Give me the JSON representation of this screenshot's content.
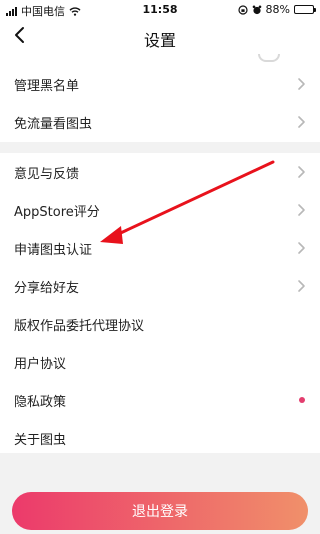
{
  "status_bar": {
    "carrier": "中国电信",
    "time": "11:58",
    "battery_percent": "88%",
    "battery_level": 0.88
  },
  "header": {
    "title": "设置",
    "back_icon": "chevron-left-icon"
  },
  "section_top": {
    "items": [
      {
        "label": "管理黑名单",
        "chevron": true
      },
      {
        "label": "免流量看图虫",
        "chevron": true
      }
    ]
  },
  "section_main": {
    "items": [
      {
        "label": "意见与反馈",
        "chevron": true
      },
      {
        "label": "AppStore评分",
        "chevron": true
      },
      {
        "label": "申请图虫认证",
        "chevron": true
      },
      {
        "label": "分享给好友",
        "chevron": true
      },
      {
        "label": "版权作品委托代理协议",
        "chevron": false
      },
      {
        "label": "用户协议",
        "chevron": false
      },
      {
        "label": "隐私政策",
        "chevron": false,
        "badge_dot": true
      },
      {
        "label": "关于图虫",
        "chevron": false
      }
    ]
  },
  "footer": {
    "logout_label": "退出登录"
  },
  "colors": {
    "accent_start": "#ec3a6b",
    "accent_end": "#f0906a",
    "dot": "#e33d6e",
    "annotation_arrow": "#e8121c",
    "chevron": "#b8b8b8"
  }
}
